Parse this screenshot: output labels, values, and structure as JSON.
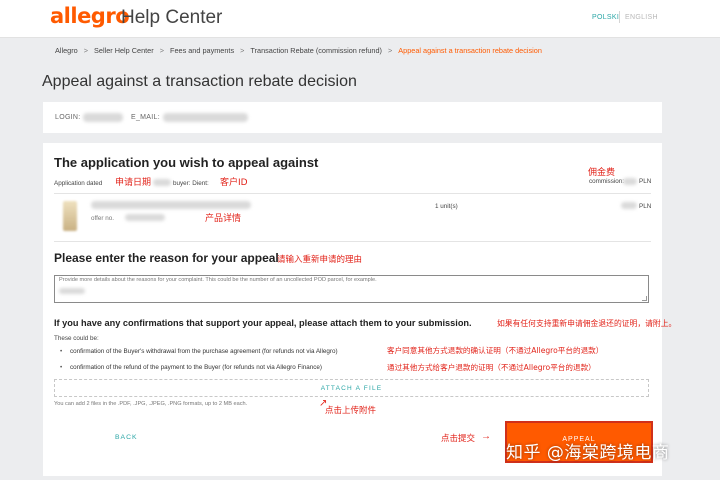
{
  "header": {
    "logo": "allegro",
    "title": "Help Center",
    "lang_pl": "POLSKI",
    "lang_en": "ENGLISH"
  },
  "breadcrumb": {
    "items": [
      "Allegro",
      "Seller Help Center",
      "Fees and payments",
      "Transaction Rebate (commission refund)",
      "Appeal against a transaction rebate decision"
    ],
    "separator": ">"
  },
  "page_title": "Appeal against a transaction rebate decision",
  "login_card": {
    "login_label": "LOGIN:",
    "email_label": "E_MAIL:"
  },
  "application": {
    "heading": "The application you wish to appeal against",
    "date_label": "Application dated",
    "buyer_label": "buyer: Dient:",
    "commission_label": "commission:",
    "commission_currency": "PLN",
    "offer_label": "offer no.",
    "quantity": "1 unit(s)",
    "price_currency": "PLN"
  },
  "reason": {
    "heading": "Please enter the reason for your appeal",
    "placeholder": "Provide more details about the reasons for your complaint. This could be the number of an uncollected POD parcel, for example."
  },
  "confirmations": {
    "heading": "If you have any confirmations that support your appeal, please attach them to your submission.",
    "could_be": "These could be:",
    "items": [
      "confirmation of the Buyer's withdrawal from the purchase agreement (for refunds not via Allegro)",
      "confirmation of the refund of the payment to the Buyer (for refunds not via Allegro Finance)"
    ],
    "attach_label": "ATTACH A FILE",
    "attach_hint": "You can add 2 files in the .PDF, .JPG, .JPEG, .PNG formats, up to 2 MB each."
  },
  "actions": {
    "back_label": "BACK",
    "appeal_label": "APPEAL"
  },
  "annotations": {
    "commission_fee": "佣金费",
    "application_date": "申请日期",
    "customer_id": "客户ID",
    "product_details": "产品详情",
    "reenter_reason": "请输入重新申请的理由",
    "attach_proof": "如果有任何支持重新申请佣金退还的证明，请附上。",
    "customer_agreed": "客户同意其他方式退款的确认证明（不通过Allegro平台的退款）",
    "refund_proof": "通过其他方式给客户退款的证明（不通过Allegro平台的退款）",
    "click_upload": "点击上传附件",
    "click_submit": "点击提交"
  },
  "watermark": "知乎 @海棠跨境电商",
  "colors": {
    "brand": "#ff5a00",
    "link": "#2aa6a6",
    "annotation": "#e2231a",
    "background": "#ecedef"
  }
}
